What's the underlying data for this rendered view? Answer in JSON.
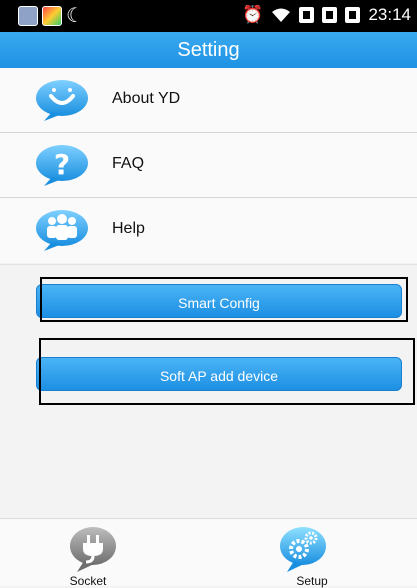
{
  "status_bar": {
    "time": "23:14"
  },
  "header": {
    "title": "Setting"
  },
  "menu": {
    "items": [
      {
        "label": "About YD",
        "icon": "smiley-icon"
      },
      {
        "label": "FAQ",
        "icon": "question-icon"
      },
      {
        "label": "Help",
        "icon": "people-icon"
      }
    ]
  },
  "actions": {
    "smart_config": "Smart Config",
    "soft_ap": "Soft AP add device"
  },
  "nav": {
    "tabs": [
      {
        "label": "Socket",
        "icon": "plug-icon"
      },
      {
        "label": "Setup",
        "icon": "gears-icon"
      }
    ]
  },
  "colors": {
    "accent": "#1e92e4",
    "status_bar": "#000000",
    "background": "#f3f3f3"
  }
}
